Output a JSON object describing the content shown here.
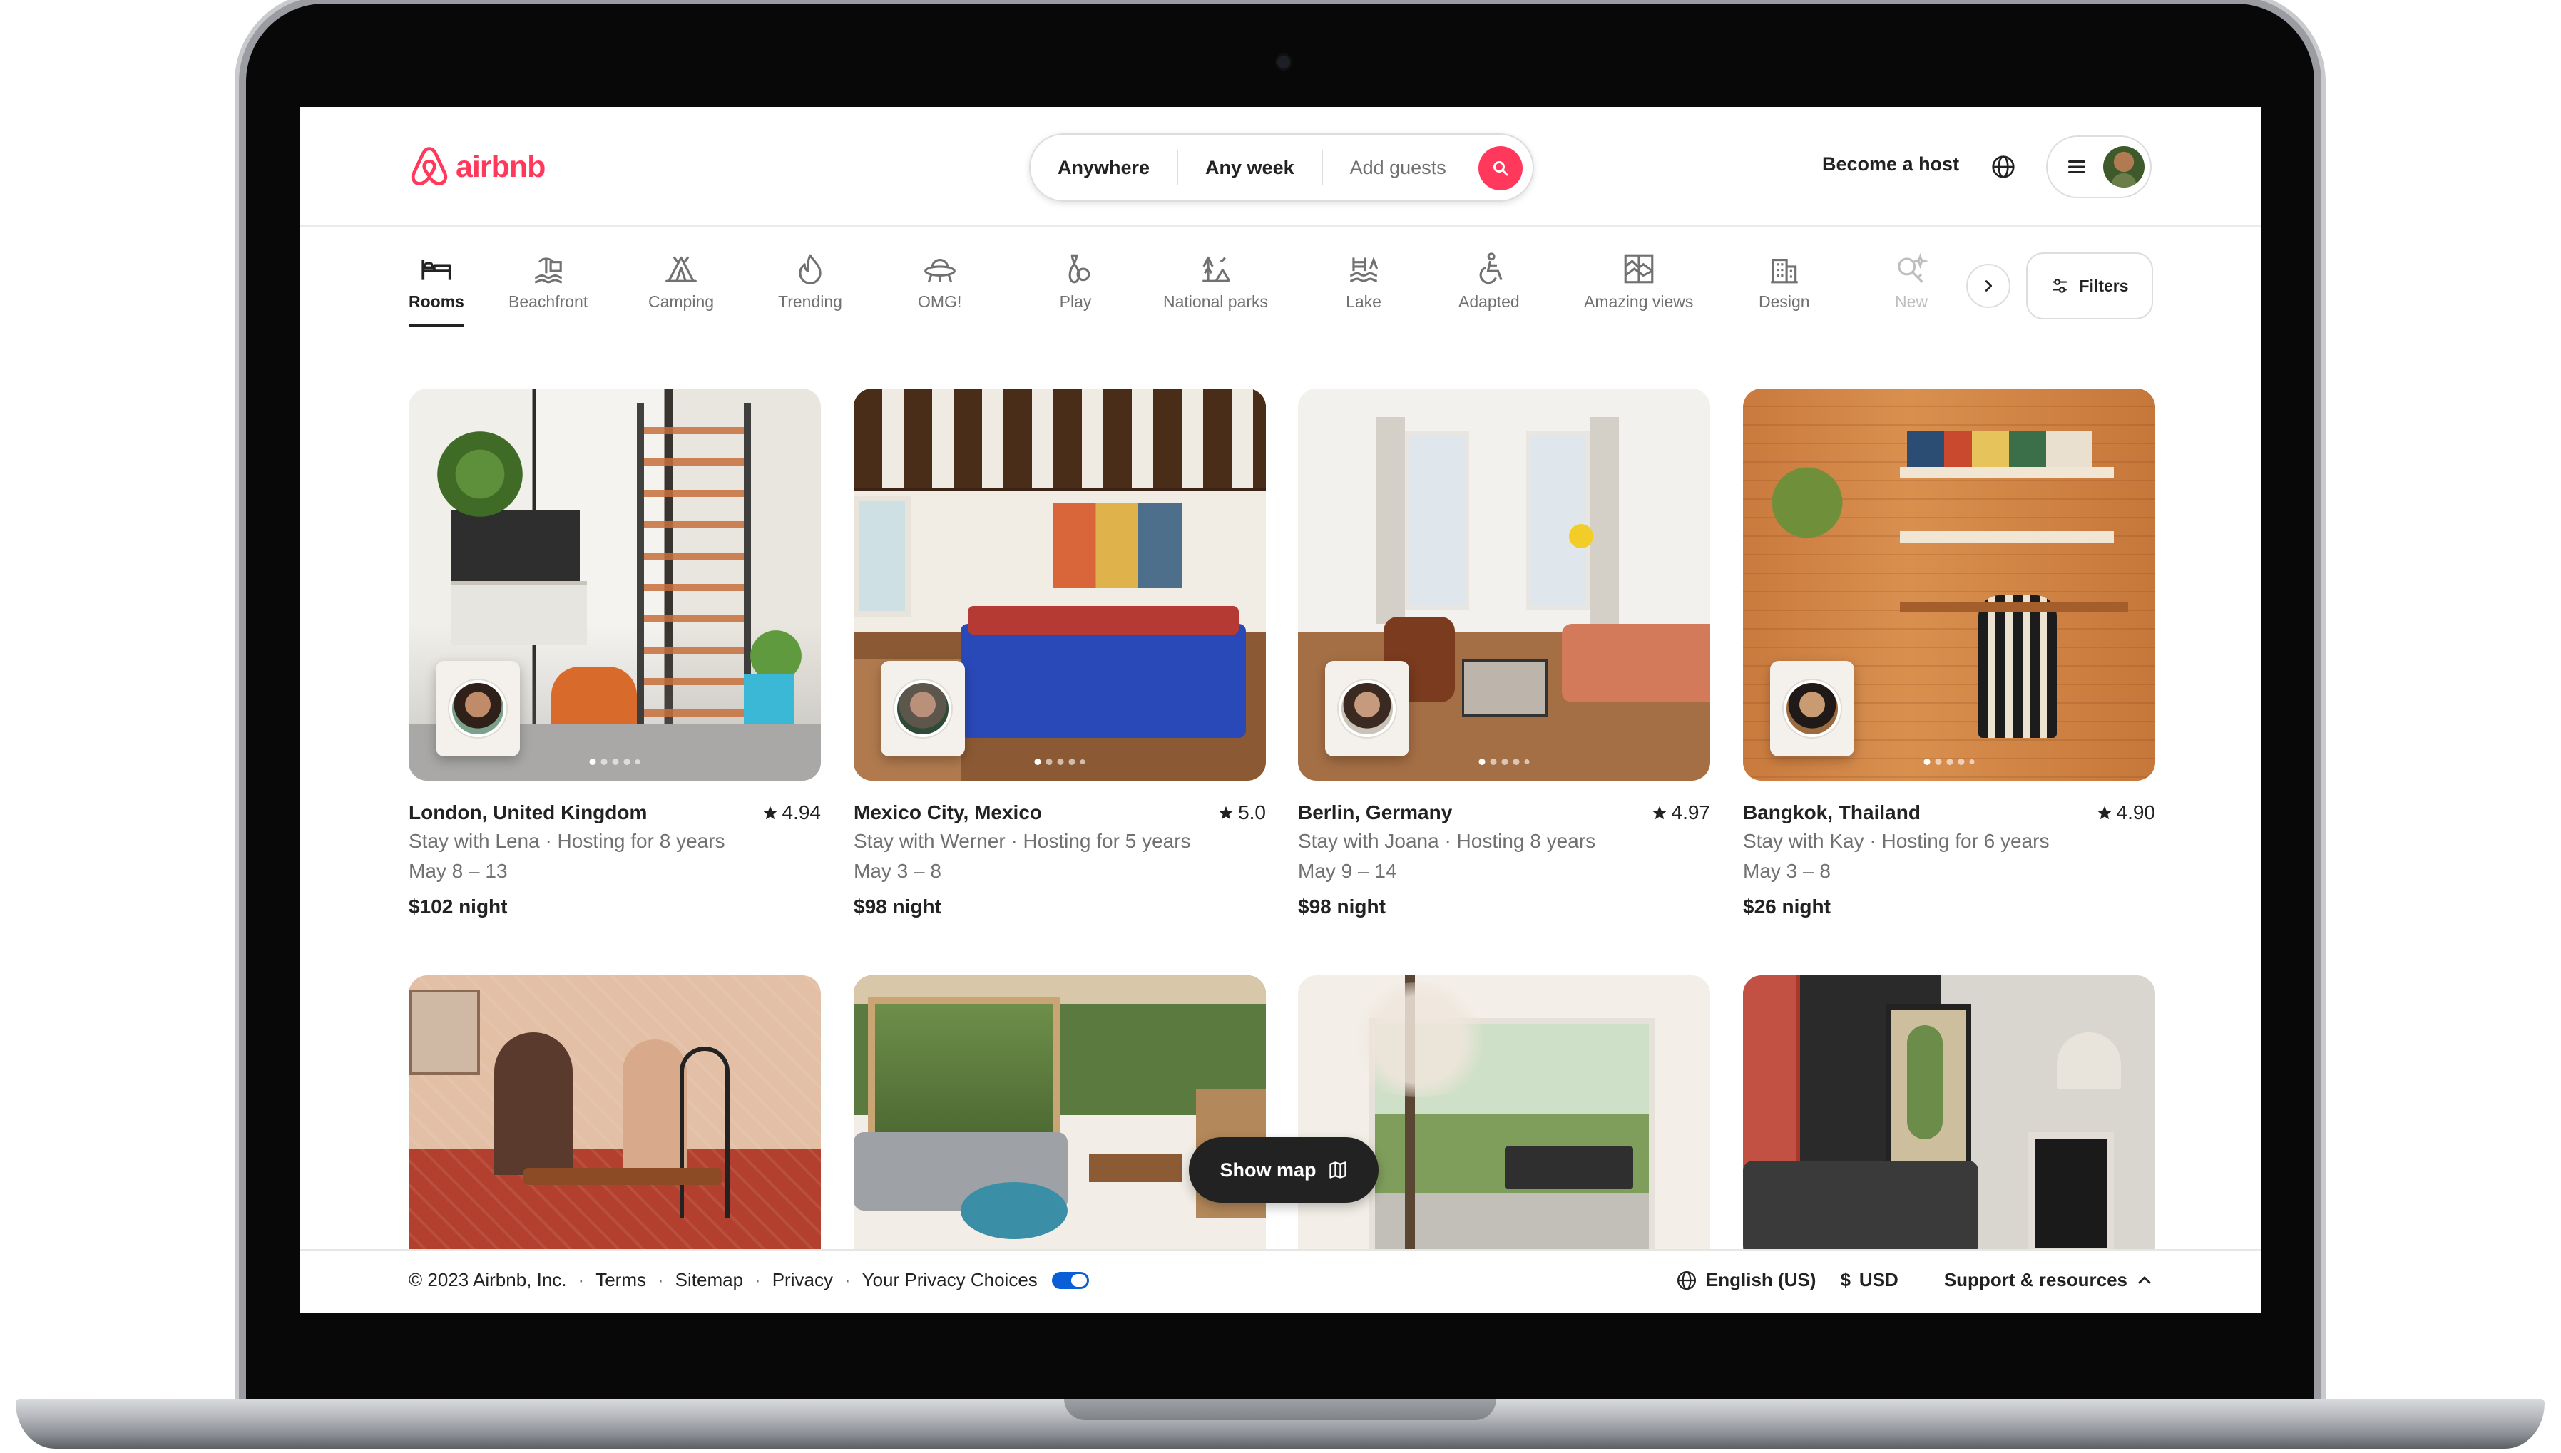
{
  "header": {
    "logo_text": "airbnb",
    "search": {
      "location": "Anywhere",
      "dates": "Any week",
      "guests_placeholder": "Add guests"
    },
    "become_host": "Become a host"
  },
  "categories": [
    {
      "label": "Rooms",
      "icon": "bed-icon",
      "active": true
    },
    {
      "label": "Beachfront",
      "icon": "beach-icon"
    },
    {
      "label": "Camping",
      "icon": "tent-icon"
    },
    {
      "label": "Trending",
      "icon": "flame-icon"
    },
    {
      "label": "OMG!",
      "icon": "ufo-icon"
    },
    {
      "label": "Play",
      "icon": "bowling-pin-icon"
    },
    {
      "label": "National parks",
      "icon": "park-icon"
    },
    {
      "label": "Lake",
      "icon": "lake-icon"
    },
    {
      "label": "Adapted",
      "icon": "accessible-icon"
    },
    {
      "label": "Amazing views",
      "icon": "views-icon"
    },
    {
      "label": "Design",
      "icon": "building-icon"
    },
    {
      "label": "New",
      "icon": "sparkle-key-icon"
    }
  ],
  "filters_label": "Filters",
  "listings": [
    {
      "title": "London, United Kingdom",
      "rating": "4.94",
      "host": "Stay with Lena · Hosting for 8 years",
      "dates": "May 8 – 13",
      "price": "$102 night"
    },
    {
      "title": "Mexico City, Mexico",
      "rating": "5.0",
      "host": "Stay with Werner · Hosting for 5 years",
      "dates": "May 3 – 8",
      "price": "$98 night"
    },
    {
      "title": "Berlin, Germany",
      "rating": "4.97",
      "host": "Stay with Joana · Hosting 8 years",
      "dates": "May 9 – 14",
      "price": "$98 night"
    },
    {
      "title": "Bangkok, Thailand",
      "rating": "4.90",
      "host": "Stay with Kay · Hosting for 6 years",
      "dates": "May 3 – 8",
      "price": "$26 night"
    }
  ],
  "show_map_label": "Show map",
  "footer": {
    "copyright": "© 2023 Airbnb, Inc.",
    "links": [
      "Terms",
      "Sitemap",
      "Privacy",
      "Your Privacy Choices"
    ],
    "language": "English (US)",
    "currency_symbol": "$",
    "currency": "USD",
    "support": "Support & resources"
  },
  "colors": {
    "brand": "#FF385C",
    "text": "#222222",
    "muted": "#717171",
    "privacy_toggle": "#0A5FD8"
  }
}
